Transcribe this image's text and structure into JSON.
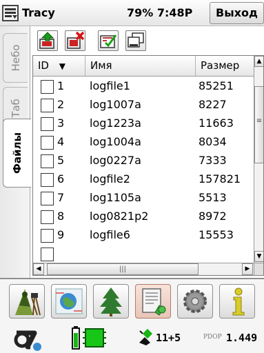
{
  "titlebar": {
    "app_name": "Tracy",
    "status": "79% 7:48P",
    "exit_label": "Выход"
  },
  "side_tabs": [
    {
      "label": "Небо",
      "active": false
    },
    {
      "label": "Таб",
      "active": false
    },
    {
      "label": "Файлы",
      "active": true
    }
  ],
  "toolbar": {
    "buttons": [
      "upload-icon",
      "delete-icon",
      "check-all-icon",
      "uncheck-icon"
    ]
  },
  "table": {
    "columns": [
      "ID",
      "Имя",
      "Размер"
    ],
    "sort_indicator": "▼",
    "rows": [
      {
        "id": "1",
        "name": "logfile1",
        "size": "85251"
      },
      {
        "id": "2",
        "name": "log1007a",
        "size": "8227"
      },
      {
        "id": "3",
        "name": "log1223a",
        "size": "11663"
      },
      {
        "id": "4",
        "name": "log1004a",
        "size": "8034"
      },
      {
        "id": "5",
        "name": "log0227a",
        "size": "7333"
      },
      {
        "id": "6",
        "name": "logfile2",
        "size": "157821"
      },
      {
        "id": "7",
        "name": "log1105a",
        "size": "5513"
      },
      {
        "id": "8",
        "name": "log0821p2",
        "size": "8972"
      },
      {
        "id": "9",
        "name": "logfile6",
        "size": "15553"
      }
    ]
  },
  "dock": {
    "buttons": [
      "survey-icon",
      "map-icon",
      "tree-icon",
      "files-icon",
      "settings-icon",
      "info-icon"
    ],
    "selected": "files-icon"
  },
  "status": {
    "satellites": "11+5",
    "pdop_label": "PDOP",
    "pdop_value": "1.449"
  },
  "colors": {
    "gps_green": "#19b514",
    "battery_green": "#18c618",
    "selected_bg": "#e8c5b8",
    "info_yellow": "#d8cc2a"
  }
}
